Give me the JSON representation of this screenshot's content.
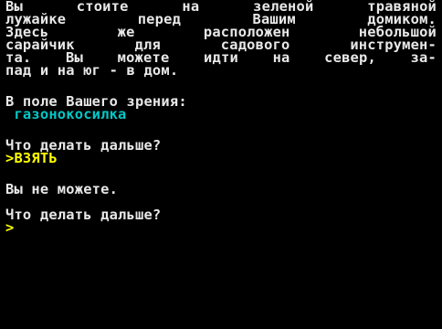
{
  "colors": {
    "background": "#000000",
    "text": "#e8e8e8",
    "item": "#00c8c8",
    "input": "#ffff00"
  },
  "description": [
    "Вы стоите на зеленой травяной",
    "лужайке перед Вашим домиком.",
    "Здесь же расположен небольшой",
    "сарайчик для садового инструмен-",
    "та. Вы можете идти на север, за-",
    "пад и на юг - в дом."
  ],
  "visible_header": "В поле Вашего зрения:",
  "visible_items": [
    " газонокосилка"
  ],
  "prompt_question_1": "Что делать дальше?",
  "prompt_symbol": ">",
  "user_command": "ВЗЯТЬ",
  "response": "Вы не можете.",
  "prompt_question_2": "Что делать дальше?"
}
